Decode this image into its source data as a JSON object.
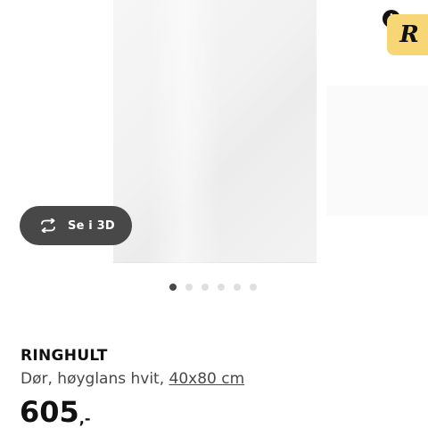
{
  "gallery": {
    "view_3d_label": "Se i 3D",
    "view_3d_icon": "rotate-3d-icon",
    "dot_count": 6,
    "active_dot": 0
  },
  "badge": {
    "letter": "R",
    "info_symbol": "i",
    "color": "#f6d675"
  },
  "product": {
    "name": "RINGHULT",
    "description": "Dør, høyglans hvit,",
    "size": "40x80 cm",
    "price_integer": "605",
    "price_suffix": ",-"
  }
}
